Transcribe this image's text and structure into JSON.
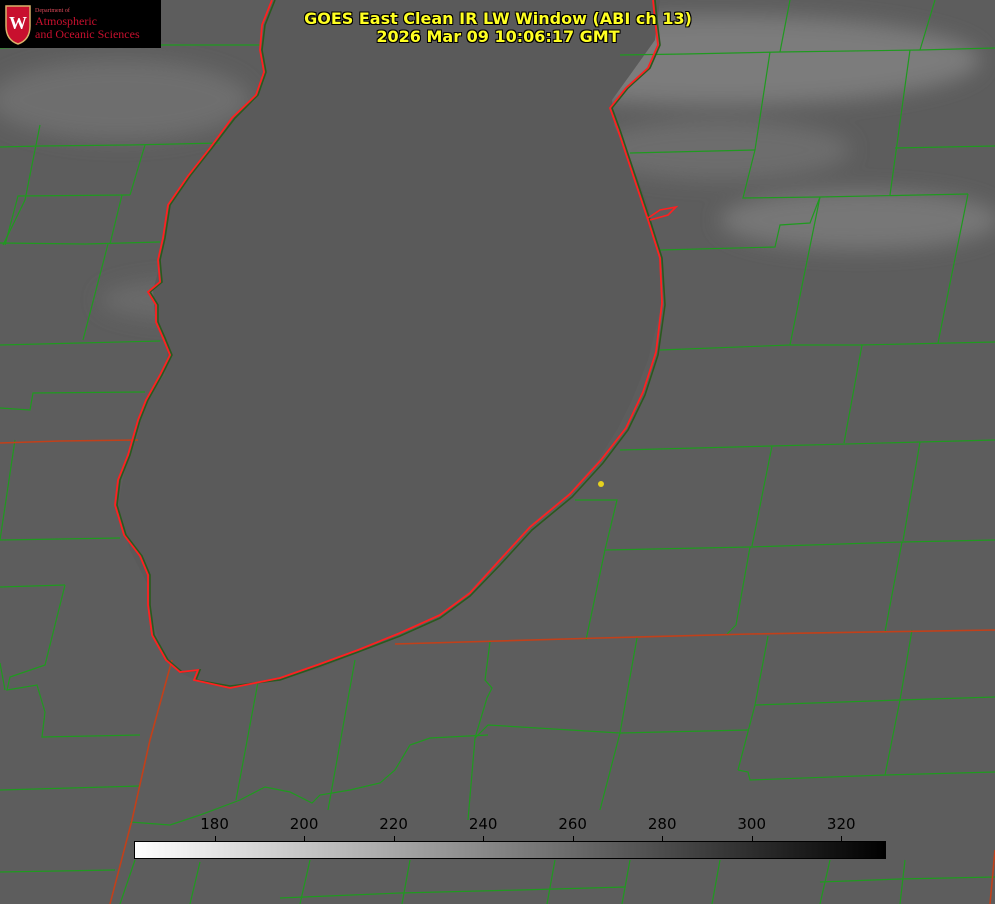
{
  "title": {
    "line1": "GOES East Clean IR LW Window (ABI ch 13)",
    "line2": "2026 Mar 09 10:06:17 GMT"
  },
  "logo": {
    "dept": "Department of",
    "line1": "Atmospheric",
    "line2": "and Oceanic Sciences",
    "emblem_letter": "W"
  },
  "colorbar": {
    "ticks": [
      "180",
      "200",
      "220",
      "240",
      "260",
      "280",
      "300",
      "320"
    ],
    "tick_values": [
      180,
      200,
      220,
      240,
      260,
      280,
      300,
      320
    ],
    "min": 162,
    "max": 330,
    "low_color": "#ffffff",
    "high_color": "#000000"
  },
  "colors": {
    "coastline": "#ff2020",
    "county_lines": "#1f9a1f",
    "state_lines": "#c2401a",
    "marker": "#e6d21e",
    "title": "#ffff22",
    "logo_red": "#c8102e"
  }
}
